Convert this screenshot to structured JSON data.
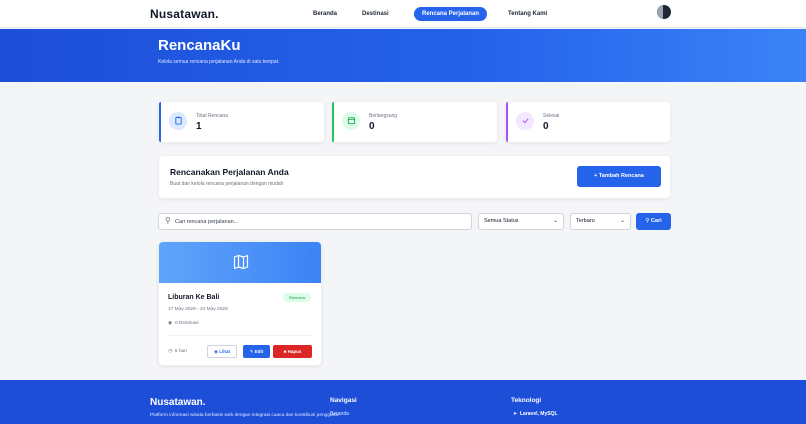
{
  "nav": {
    "brand": "Nusatawan.",
    "links": [
      {
        "label": "Beranda"
      },
      {
        "label": "Destinasi"
      },
      {
        "label": "Rencana Perjalanan",
        "active": true
      },
      {
        "label": "Tentang Kami"
      }
    ]
  },
  "hero": {
    "title": "RencanaKu",
    "subtitle": "Kelola semua rencana perjalanan Anda di satu tempat."
  },
  "stats": [
    {
      "label": "Total Rencana",
      "value": "1",
      "icon": "clipboard-icon",
      "color": "#2563eb"
    },
    {
      "label": "Berlangsung",
      "value": "0",
      "icon": "calendar-icon",
      "color": "#22c55e"
    },
    {
      "label": "Selesai",
      "value": "0",
      "icon": "check-icon",
      "color": "#a855f7"
    }
  ],
  "plan": {
    "title": "Rencanakan Perjalanan Anda",
    "subtitle": "Buat dan kelola rencana perjalanan dengan mudah",
    "add_button": "+ Tambah Rencana"
  },
  "filters": {
    "search_placeholder": "Cari rencana perjalanan...",
    "status": "Semua Status",
    "sort": "Terbaru",
    "search_button": "Cari"
  },
  "trips": [
    {
      "name": "Liburan Ke Bali",
      "badge": "Rencana",
      "dates": "17 May 2025 - 24 May 2025",
      "destinations": "0 Destinasi",
      "duration": "6 hari",
      "view_label": "Lihat",
      "edit_label": "Edit",
      "delete_label": "Hapus"
    }
  ],
  "footer": {
    "brand": "Nusatawan.",
    "description": "Platform informasi wisata berbasis web dengan integrasi cuaca dan kontribusi pengguna.",
    "nav_heading": "Navigasi",
    "nav_item": "Beranda",
    "tech_heading": "Teknologi",
    "tech_item": "Laravel, MySQL"
  },
  "colors": {
    "primary": "#2563eb",
    "danger": "#dc2626",
    "success": "#22c55e",
    "purple": "#a855f7"
  }
}
